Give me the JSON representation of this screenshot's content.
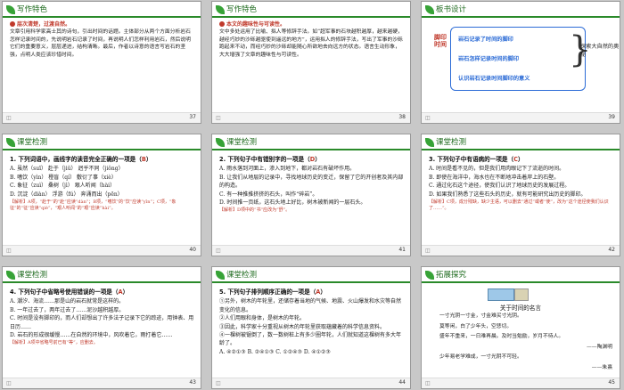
{
  "slides": [
    {
      "title": "写作特色",
      "page": "37",
      "subhead": "层次清楚，过渡自然。",
      "text": "文章引用科学家高士其的诗句，引出时间的话题。主体部分从两个方面分析岩石怎样记录时间的，先说明岩石记录了时间，再说明人们怎样利用岩石，然后说明它们的重要意义，层层递进，结构清晰。最后，作者以诗意的语言写岩石的坚强，点明人类应该珍惜时间。"
    },
    {
      "title": "写作特色",
      "page": "38",
      "subhead": "本文的趣味性与可读性。",
      "text": "文中多处运用了比喻、拟人等修辞手法。如“超军事的石块越积越厚，越来越硬，越经巧妙的沙砾越驱使到遥远的地方”，运用拟人的修辞手法，写出了军事的沙砾跑起来不动，而经巧妙的沙砾却能随心所欲地去向远方的状态。语言生动形象，大大增强了文章的趣味性与可读性。"
    },
    {
      "title": "板书设计",
      "page": "39",
      "left_label": "脚印时间",
      "lines": [
        "岩石记录了时间的脚印",
        "岩石怎样记录时间的脚印",
        "认识岩石记录时间脚印的意义"
      ],
      "right_label": "探索大自然的奥秘"
    },
    {
      "title": "课堂检测",
      "page": "40",
      "question": "1. 下列词语中，画线字的读音完全正确的一项是（",
      "answer": "B",
      "question_end": "）",
      "options": [
        "A. 虽然（suī）   赴于（jiǔ）  迥乎不同（jiǒng）",
        "B. 嗜饮（yìn）   橙盲（qí）   敷衍了事（xiè）",
        "C. 象征（zuì）   桑树（jì）   艰人听闻（hài）",
        "D. 沉淀（diàn）  浮游（fú）   奔涌而出（pēn）"
      ],
      "explanation": "【解析】A项，“赴于”的“赴”应读“dàn”；B项，“嗜饮”的“饮”应读“yīn”；C项，“象征”的“征”应读“qiè”，“艰人听闻”的“艰”应读“hài”。"
    },
    {
      "title": "课堂检测",
      "page": "41",
      "question": "2. 下列句子中有错别字的一项是（",
      "answer": "D",
      "question_end": "）",
      "options": [
        "A. 雨水落到河面上，渗入到地下，都对岩石有破坏作用。",
        "B. 让我们从地层的记录中，寻找地球历史的变迁，保留了它的开创者及其内部的构造。",
        "C. 有一种推推挤挤的石头，叫作“碎岩”。",
        "D. 时间推一页纸，这石头地上好比，树木被新闻的一层石头。"
      ],
      "explanation": "【解析】D项中的“书”应改为“舒”。"
    },
    {
      "title": "课堂检测",
      "page": "42",
      "question": "3. 下列句子中有语病的一项是（",
      "answer": "C",
      "question_end": "）",
      "options": [
        "A. 时间是看不见的，但是我们用肉眼记下了流逝的时间。",
        "B. 即使在海洋中，海水也在不断地冲击着岸上的石壁。",
        "C. 通过化石这个途径，使我们认识了地球历史的发展过程。",
        "D. 如果我们熟悉了这些石头的历史，就有可能研究出历史的脚印。"
      ],
      "explanation": "【解析】C项，成分残缺，缺少主语，可以删去“通过”或者“使”，改为“这个途径使我们认识了……”。"
    },
    {
      "title": "课堂检测",
      "page": "43",
      "question": "4. 下列句子中省略号使用错误的一项是（",
      "answer": "A",
      "question_end": "）",
      "options": [
        "A. 潮汐、海流……那是山的岩石就常是这样的。",
        "B. 一年过去了，两年过去了……泥沙越积越厚。",
        "C. 时间是没有脚印的，而人们却想出了许多法子记录下它的踪迹，用钟表、用日历……",
        "D. 岩石的形成很缓慢……在自然的环境中，风吹着它，雨打着它……"
      ],
      "explanation": "【解析】A项中省略号前已有“等”，应删去。"
    },
    {
      "title": "课堂检测",
      "page": "44",
      "question": "5. 下列句子排列顺序正确的一项是（",
      "answer": "A",
      "question_end": "）",
      "options": [
        "①另外，树木的年轮里，还储存着当地的气候、地震、火山爆发和水灾等自然变化的信息。",
        "②人们用眼和身体，是树木的年轮。",
        "③因此，科学家十分重视从树木的年轮里获取蕴藏着的科学信息资料。",
        "④一棵树被锯倒了，数一数树桩上有多少圈年轮，人们就知道这棵树有多大年龄了。",
        "A. ④②①③   B. ②④①③   C. ①②④③   D. ④①②③"
      ],
      "explanation": ""
    },
    {
      "title": "拓展探究",
      "page": "45",
      "poem_title": "关于时间的名言",
      "lines": [
        "一寸光阴一寸金，寸金难买寸光阴。",
        "莫等闲，白了少年头，空悲切。",
        "盛年不重来，一日难再晨。及时当勉励，岁月不待人。",
        "——陶渊明",
        "少年易老学难成，一寸光阴不可轻。",
        "——朱熹"
      ]
    }
  ]
}
